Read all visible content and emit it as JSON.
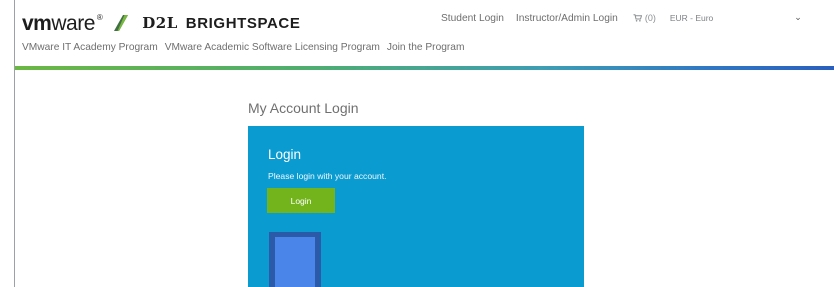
{
  "header": {
    "brand": {
      "vm_bold": "vm",
      "vm_light": "ware",
      "registered": "®",
      "partner_prefix": "D2L",
      "partner_name": "BRIGHTSPACE"
    },
    "sub_nav": [
      {
        "label": "VMware IT Academy Program"
      },
      {
        "label": "VMware Academic Software Licensing Program"
      },
      {
        "label": "Join the Program"
      }
    ],
    "top_links": {
      "student_login": "Student Login",
      "instructor_login": "Instructor/Admin Login",
      "cart_icon": "cart-icon",
      "cart_count": "(0)",
      "currency": "EUR - Euro",
      "currency_caret": "⌄"
    },
    "accent_gradient": [
      "#6bb743",
      "#3d9db4",
      "#2a5fbd"
    ]
  },
  "main": {
    "page_title": "My Account Login",
    "panel": {
      "title": "Login",
      "subtitle": "Please login with your account.",
      "button_label": "Login",
      "background_color": "#0a9bd1",
      "button_color": "#73b41c"
    }
  }
}
